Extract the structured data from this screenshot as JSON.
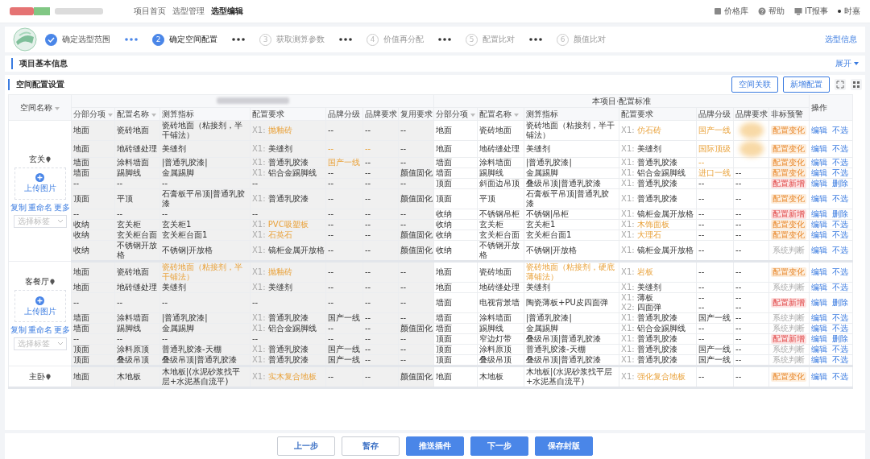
{
  "header": {
    "breadcrumb": [
      {
        "label": "项目首页",
        "current": false
      },
      {
        "label": "选型管理",
        "current": false
      },
      {
        "label": "选型编辑",
        "current": true
      }
    ],
    "tools": [
      {
        "kind": "price",
        "label": "价格库"
      },
      {
        "kind": "help",
        "label": "帮助"
      },
      {
        "kind": "report",
        "label": "IT报事"
      }
    ],
    "user": "时嘉"
  },
  "steps": [
    {
      "label": "确定选型范围",
      "done": true,
      "selected": false
    },
    {
      "number": "2",
      "label": "确定空间配置",
      "done": false,
      "selected": true
    },
    {
      "number": "3",
      "label": "获取测算参数",
      "done": false,
      "selected": false
    },
    {
      "number": "4",
      "label": "价值再分配",
      "done": false,
      "selected": false
    },
    {
      "number": "5",
      "label": "配置比对",
      "done": false,
      "selected": false
    },
    {
      "number": "6",
      "label": "颜值比对",
      "done": false,
      "selected": false
    }
  ],
  "steps_link": "选型信息",
  "basic_section": {
    "title": "项目基本信息",
    "toggle": "展开"
  },
  "config_section": {
    "title": "空间配置设置",
    "buttons": [
      "空间关联",
      "新增配置"
    ]
  },
  "table": {
    "space_column": {
      "label": "空间名称",
      "sortable": true
    },
    "right_group": "本项目·配置标准",
    "ops_label": "操作",
    "left_columns": [
      {
        "label": "分部分项",
        "sortable": true
      },
      {
        "label": "配置名称",
        "sortable": true
      },
      {
        "label": "测算指标"
      },
      {
        "label": "配置要求"
      },
      {
        "label": "品牌分级"
      },
      {
        "label": "品牌要求"
      },
      {
        "label": "复用要求"
      }
    ],
    "right_columns": [
      {
        "label": "分部分项",
        "sortable": true
      },
      {
        "label": "配置名称",
        "sortable": true
      },
      {
        "label": "测算指标"
      },
      {
        "label": "配置要求"
      },
      {
        "label": "品牌分级"
      },
      {
        "label": "品牌要求"
      },
      {
        "label": "非标预警"
      }
    ],
    "groups": [
      {
        "name": "玄关",
        "upload": "上传图片",
        "links": [
          "复制",
          "重命名",
          "更多"
        ],
        "tag_select": "选择标签",
        "rows": [
          {
            "left": [
              "地面",
              "瓷砖地面",
              "瓷砖地面（粘接剂，半干铺法）",
              [
                {
                  "prefix": "X1:",
                  "text": "抛釉砖",
                  "highlight": true
                }
              ],
              "--",
              "--",
              "--"
            ],
            "right": [
              "地面",
              "瓷砖地面",
              "瓷砖地面（粘接剂，半干铺法）",
              [
                {
                  "prefix": "X1:",
                  "text": "仿石砖",
                  "highlight": true
                }
              ],
              {
                "text": "国产一线",
                "highlight": true
              },
              {
                "kind": "blurred"
              }
            ],
            "warning": {
              "text": "配置变化",
              "kind": "change"
            },
            "ops": [
              "编辑",
              "不选"
            ]
          },
          {
            "left": [
              "地面",
              "地砖缝处理",
              "美缝剂",
              [
                {
                  "prefix": "X1:",
                  "text": "美缝剂",
                  "highlight": false
                }
              ],
              {
                "text": "--",
                "highlight": true
              },
              {
                "text": "--",
                "highlight": true
              },
              "--"
            ],
            "right": [
              "地面",
              "地砖缝处理",
              "美缝剂",
              [
                {
                  "prefix": "X1:",
                  "text": "美缝剂",
                  "highlight": false
                }
              ],
              {
                "text": "国际顶级",
                "highlight": true
              },
              {
                "kind": "blurred"
              }
            ],
            "warning": {
              "text": "配置变化",
              "kind": "change"
            },
            "ops": [
              "编辑",
              "不选"
            ]
          },
          {
            "left": [
              "墙面",
              "涂料墙面",
              "|普通乳胶漆|",
              [
                {
                  "prefix": "X1:",
                  "text": "普通乳胶漆",
                  "highlight": false
                }
              ],
              {
                "text": "国产一线",
                "highlight": true
              },
              "--",
              "--"
            ],
            "right": [
              "墙面",
              "涂料墙面",
              "|普通乳胶漆|",
              [
                {
                  "prefix": "X1:",
                  "text": "普通乳胶漆",
                  "highlight": false
                }
              ],
              {
                "text": "--",
                "highlight": true
              }
            ],
            "warning": {
              "text": "配置变化",
              "kind": "change"
            },
            "ops": [
              "编辑",
              "不选"
            ]
          },
          {
            "left": [
              "墙面",
              "踢脚线",
              "金属踢脚",
              [
                {
                  "prefix": "X1:",
                  "text": "铝合金踢脚线",
                  "highlight": false
                }
              ],
              "--",
              "--",
              "颜值固化"
            ],
            "right": [
              "墙面",
              "踢脚线",
              "金属踢脚",
              [
                {
                  "prefix": "X1:",
                  "text": "铝合金踢脚线",
                  "highlight": false
                }
              ],
              {
                "text": "进口一线",
                "highlight": true
              },
              "--"
            ],
            "warning": {
              "text": "配置变化",
              "kind": "change"
            },
            "ops": [
              "编辑",
              "不选"
            ]
          },
          {
            "left": [
              "--",
              "--",
              "--",
              "--",
              "--",
              "--",
              "--"
            ],
            "right": [
              "顶面",
              "斜面边吊顶",
              "叠级吊顶|普通乳胶漆",
              [
                {
                  "prefix": "X1:",
                  "text": "普通乳胶漆",
                  "highlight": false
                }
              ],
              "--",
              "--"
            ],
            "warning": {
              "text": "配置新增",
              "kind": "new"
            },
            "ops": [
              "编辑",
              "删除"
            ]
          },
          {
            "left": [
              "顶面",
              "平顶",
              "石膏板平吊顶|普通乳胶漆",
              [
                {
                  "prefix": "X1:",
                  "text": "普通乳胶漆",
                  "highlight": false
                }
              ],
              "--",
              "--",
              "颜值固化"
            ],
            "right": [
              "顶面",
              "平顶",
              "石膏板平吊顶|普通乳胶漆",
              [
                {
                  "prefix": "X1:",
                  "text": "普通乳胶漆",
                  "highlight": false
                }
              ],
              "--",
              "--"
            ],
            "warning": {
              "text": "配置变化",
              "kind": "change"
            },
            "ops": [
              "编辑",
              "不选"
            ]
          },
          {
            "left": [
              "--",
              "--",
              "--",
              "--",
              "--",
              "--",
              "--"
            ],
            "right": [
              "收纳",
              "不锈钢吊柜",
              "不锈钢|吊柜",
              [
                {
                  "prefix": "X1:",
                  "text": "镜柜金属开放格",
                  "highlight": false
                }
              ],
              "--",
              "--"
            ],
            "warning": {
              "text": "配置新增",
              "kind": "new"
            },
            "ops": [
              "编辑",
              "删除"
            ]
          },
          {
            "left": [
              "收纳",
              "玄关柜",
              "玄关柜1",
              [
                {
                  "prefix": "X1:",
                  "text": "PVC吸塑板",
                  "highlight": true
                }
              ],
              "--",
              "--",
              "--"
            ],
            "right": [
              "收纳",
              "玄关柜",
              "玄关柜1",
              [
                {
                  "prefix": "X1:",
                  "text": "木饰面板",
                  "highlight": true
                }
              ],
              "--",
              "--"
            ],
            "warning": {
              "text": "配置变化",
              "kind": "change"
            },
            "ops": [
              "编辑",
              "不选"
            ]
          },
          {
            "left": [
              "收纳",
              "玄关柜台面",
              "玄关柜台面1",
              [
                {
                  "prefix": "X1:",
                  "text": "石英石",
                  "highlight": true
                }
              ],
              "--",
              "--",
              "颜值固化"
            ],
            "right": [
              "收纳",
              "玄关柜台面",
              "玄关柜台面1",
              [
                {
                  "prefix": "X1:",
                  "text": "大理石",
                  "highlight": true
                }
              ],
              "--",
              "--"
            ],
            "warning": {
              "text": "配置变化",
              "kind": "change"
            },
            "ops": [
              "编辑",
              "不选"
            ]
          },
          {
            "left": [
              "收纳",
              "不锈钢开放格",
              "不锈钢|开放格",
              [
                {
                  "prefix": "X1:",
                  "text": "镜柜金属开放格",
                  "highlight": false
                }
              ],
              "--",
              "--",
              "颜值固化"
            ],
            "right": [
              "收纳",
              "不锈钢开放格",
              "不锈钢|开放格",
              [
                {
                  "prefix": "X1:",
                  "text": "镜柜金属开放格",
                  "highlight": false
                }
              ],
              "--",
              "--"
            ],
            "warning": {
              "text": "系统判断",
              "kind": "system"
            },
            "ops": [
              "编辑",
              "不选"
            ]
          }
        ]
      },
      {
        "name": "客餐厅",
        "upload": "上传图片",
        "links": [
          "复制",
          "重命名",
          "更多"
        ],
        "tag_select": "选择标签",
        "rows": [
          {
            "left": [
              "地面",
              "瓷砖地面",
              {
                "text": "瓷砖地面（粘接剂，半干铺法）",
                "highlight": true
              },
              [
                {
                  "prefix": "X1:",
                  "text": "抛釉砖",
                  "highlight": true
                }
              ],
              "--",
              "--",
              "--"
            ],
            "right": [
              "地面",
              "瓷砖地面",
              {
                "text": "瓷砖地面（粘接剂，硬底薄铺法）",
                "highlight": true
              },
              [
                {
                  "prefix": "X1:",
                  "text": "岩板",
                  "highlight": true
                }
              ],
              "--",
              "--"
            ],
            "warning": {
              "text": "配置变化",
              "kind": "change"
            },
            "ops": [
              "编辑",
              "不选"
            ]
          },
          {
            "left": [
              "地面",
              "地砖缝处理",
              "美缝剂",
              [
                {
                  "prefix": "X1:",
                  "text": "美缝剂",
                  "highlight": false
                }
              ],
              "--",
              "--",
              "--"
            ],
            "right": [
              "地面",
              "地砖缝处理",
              "美缝剂",
              [
                {
                  "prefix": "X1:",
                  "text": "美缝剂",
                  "highlight": false
                }
              ],
              "--",
              "--"
            ],
            "warning": {
              "text": "系统判断",
              "kind": "system"
            },
            "ops": [
              "编辑",
              "不选"
            ]
          },
          {
            "left": [
              "--",
              "--",
              "--",
              "--",
              "--",
              "--",
              "--"
            ],
            "right": [
              "墙面",
              "电视背景墙",
              "陶瓷薄板+PU皮四面弹",
              [
                {
                  "prefix": "X1:",
                  "text": "薄板",
                  "highlight": false
                },
                {
                  "prefix": "X2:",
                  "text": "四面弹",
                  "highlight": false
                }
              ],
              [
                "--",
                "--"
              ],
              [
                "--",
                "--"
              ]
            ],
            "warning": {
              "text": "配置新增",
              "kind": "new"
            },
            "ops": [
              "编辑",
              "删除"
            ]
          },
          {
            "left": [
              "墙面",
              "涂料墙面",
              "|普通乳胶漆|",
              [
                {
                  "prefix": "X1:",
                  "text": "普通乳胶漆",
                  "highlight": false
                }
              ],
              "国产一线",
              "--",
              "--"
            ],
            "right": [
              "墙面",
              "涂料墙面",
              "|普通乳胶漆|",
              [
                {
                  "prefix": "X1:",
                  "text": "普通乳胶漆",
                  "highlight": false
                }
              ],
              "国产一线",
              "--"
            ],
            "warning": {
              "text": "系统判断",
              "kind": "system"
            },
            "ops": [
              "编辑",
              "不选"
            ]
          },
          {
            "left": [
              "墙面",
              "踢脚线",
              "金属踢脚",
              [
                {
                  "prefix": "X1:",
                  "text": "铝合金踢脚线",
                  "highlight": false
                }
              ],
              "--",
              "--",
              "颜值固化"
            ],
            "right": [
              "墙面",
              "踢脚线",
              "金属踢脚",
              [
                {
                  "prefix": "X1:",
                  "text": "铝合金踢脚线",
                  "highlight": false
                }
              ],
              "--",
              "--"
            ],
            "warning": {
              "text": "系统判断",
              "kind": "system"
            },
            "ops": [
              "编辑",
              "不选"
            ]
          },
          {
            "left": [
              "--",
              "--",
              "--",
              "--",
              "--",
              "--",
              "--"
            ],
            "right": [
              "顶面",
              "窄边灯带",
              "叠级吊顶|普通乳胶漆",
              [
                {
                  "prefix": "X1:",
                  "text": "普通乳胶漆",
                  "highlight": false
                }
              ],
              "--",
              "--"
            ],
            "warning": {
              "text": "配置新增",
              "kind": "new"
            },
            "ops": [
              "编辑",
              "删除"
            ]
          },
          {
            "left": [
              "顶面",
              "涂料原顶",
              "普通乳胶漆-天棚",
              [
                {
                  "prefix": "X1:",
                  "text": "普通乳胶漆",
                  "highlight": false
                }
              ],
              "国产一线",
              "--",
              "--"
            ],
            "right": [
              "顶面",
              "涂料原顶",
              "普通乳胶漆-天棚",
              [
                {
                  "prefix": "X1:",
                  "text": "普通乳胶漆",
                  "highlight": false
                }
              ],
              "国产一线",
              "--"
            ],
            "warning": {
              "text": "系统判断",
              "kind": "system"
            },
            "ops": [
              "编辑",
              "不选"
            ]
          },
          {
            "left": [
              "顶面",
              "叠级吊顶",
              "叠级吊顶|普通乳胶漆",
              [
                {
                  "prefix": "X1:",
                  "text": "普通乳胶漆",
                  "highlight": false
                }
              ],
              "国产一线",
              "--",
              "--"
            ],
            "right": [
              "顶面",
              "叠级吊顶",
              "叠级吊顶|普通乳胶漆",
              [
                {
                  "prefix": "X1:",
                  "text": "普通乳胶漆",
                  "highlight": false
                }
              ],
              "国产一线",
              "--"
            ],
            "warning": {
              "text": "系统判断",
              "kind": "system"
            },
            "ops": [
              "编辑",
              "不选"
            ]
          }
        ]
      },
      {
        "name": "主卧",
        "rows": [
          {
            "left": [
              "地面",
              "木地板",
              "木地板|(水泥砂浆找平层+水泥基自流平)",
              [
                {
                  "prefix": "X1:",
                  "text": "实木复合地板",
                  "highlight": true
                }
              ],
              "--",
              "--",
              "颜值固化"
            ],
            "right": [
              "地面",
              "木地板",
              "木地板|(水泥砂浆找平层+水泥基自流平)",
              [
                {
                  "prefix": "X1:",
                  "text": "强化复合地板",
                  "highlight": true
                }
              ],
              "--",
              "--"
            ],
            "warning": {
              "text": "配置变化",
              "kind": "change"
            },
            "ops": [
              "编辑",
              "不选"
            ]
          }
        ]
      }
    ]
  },
  "footer_buttons": [
    {
      "label": "上一步",
      "kind": "outline"
    },
    {
      "label": "暂存",
      "kind": "outline"
    },
    {
      "label": "推送插件",
      "kind": "primary"
    },
    {
      "label": "下一步",
      "kind": "primary"
    },
    {
      "label": "保存封版",
      "kind": "primary"
    }
  ]
}
